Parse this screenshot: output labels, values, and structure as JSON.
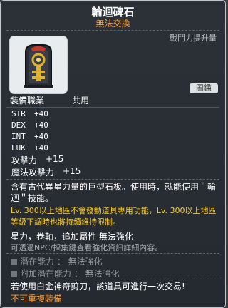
{
  "item": {
    "name": "輪迴碑石",
    "trade": "無法交換",
    "combat_label": "戰鬥力提升量",
    "preview_button": "圖鑑",
    "job_label": "裝備職業",
    "job_value": "共用"
  },
  "stats": [
    {
      "label": "STR",
      "value": "+40"
    },
    {
      "label": "DEX",
      "value": "+40"
    },
    {
      "label": "INT",
      "value": "+40"
    },
    {
      "label": "LUK",
      "value": "+40"
    }
  ],
  "stats2": [
    {
      "label": "攻擊力",
      "value": "+15"
    },
    {
      "label": "魔法攻擊力",
      "value": "+15"
    }
  ],
  "description": "含有古代異星力量的巨型石板。使用時，就能使用＂輪迴＂技能。",
  "warning": "Lv. 300以上地區不會發動道具專用功能，Lv. 300以上地區等級下調時也將持續維持限制。",
  "features": "星力，卷軸，追加屬性 無法強化",
  "features_note": "可透過NPC/採集鍵查看強化資訊詳細內容。",
  "potential": "潛在能力 ： 無法強化",
  "bonus_potential": "附加潛在能力 ： 無法強化",
  "scissors_notice": "若使用白金神奇剪刀，該道具可進行一次交易!",
  "no_duplicate": "不可重複裝備",
  "colors": {
    "accent_orange": "#ff9a2e",
    "warning_yellow": "#ffcc22",
    "panel": "#2c3138"
  },
  "icon": "tombstone-item-icon"
}
